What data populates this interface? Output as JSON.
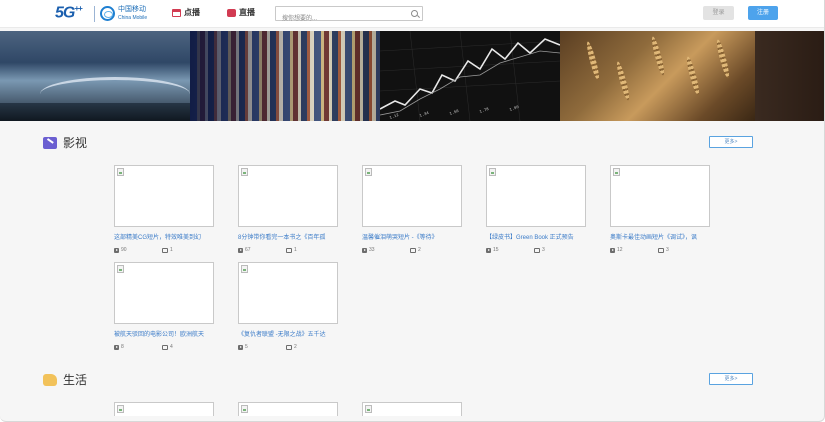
{
  "header": {
    "logo_5g": "5G",
    "logo_5g_sup": "++",
    "brand_cn": "中国移动",
    "brand_en": "China Mobile",
    "nav": [
      {
        "label": "点播",
        "icon": "film-icon"
      },
      {
        "label": "直播",
        "icon": "live-icon"
      }
    ],
    "search_placeholder": "搜你想要的...",
    "login_label": "登录",
    "register_label": "注册"
  },
  "sections": [
    {
      "title": "影视",
      "icon": "video-category-icon",
      "more_label": "更多>",
      "cards": [
        {
          "title": "这部精美CG短片，特效唯美到幻",
          "plays": "90",
          "count": "1"
        },
        {
          "title": "8分钟带你看完一本书之《百年孤",
          "plays": "67",
          "count": "1"
        },
        {
          "title": "温馨催泪萌哭短片 -《等待》",
          "plays": "33",
          "count": "2"
        },
        {
          "title": "【绿皮书】Green Book 正式预告",
          "plays": "15",
          "count": "3"
        },
        {
          "title": "奥斯卡最佳动画短片《调试》，讽",
          "plays": "12",
          "count": "3"
        },
        {
          "title": "被航天驳回的电影公司！欧洲航天",
          "plays": "8",
          "count": "4"
        },
        {
          "title": "《复仇者联盟 -无限之战》五千达",
          "plays": "5",
          "count": "2"
        }
      ]
    },
    {
      "title": "生活",
      "icon": "life-category-icon",
      "more_label": "更多>"
    }
  ],
  "colors": {
    "accent_blue": "#4da3ec",
    "link_blue": "#3a7bc8",
    "nav_red": "#d23b52"
  }
}
